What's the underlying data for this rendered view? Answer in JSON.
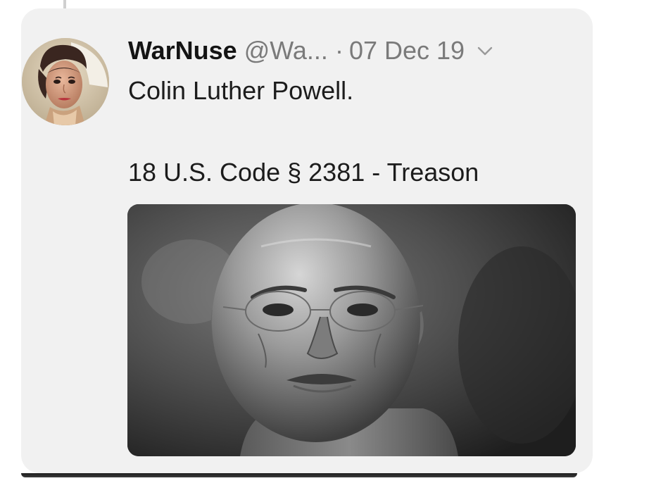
{
  "tweet": {
    "display_name": "WarNuse",
    "handle": "@Wa...",
    "separator": "·",
    "date": "07 Dec 19",
    "text_line_1": "Colin Luther Powell.",
    "text_line_2": "18 U.S. Code § 2381 - Treason"
  },
  "icons": {
    "avatar": "avatar-portrait",
    "menu": "chevron-down-icon"
  },
  "colors": {
    "card_background": "#f1f1f1",
    "name_text": "#141414",
    "meta_text": "#7a7a7a",
    "body_text": "#1c1c1c"
  }
}
